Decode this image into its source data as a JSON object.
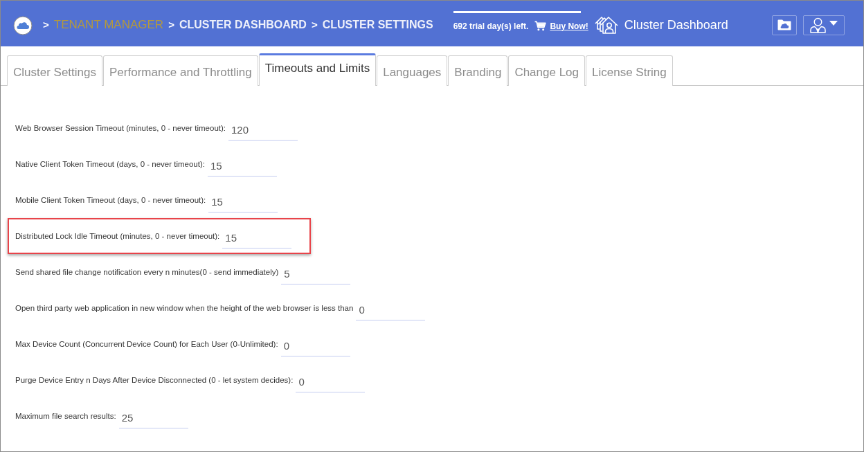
{
  "header": {
    "breadcrumb": [
      {
        "separator": ">",
        "label": "TENANT MANAGER",
        "kind": "link"
      },
      {
        "separator": ">",
        "label": "CLUSTER DASHBOARD",
        "kind": "page"
      },
      {
        "separator": ">",
        "label": "CLUSTER SETTINGS",
        "kind": "page"
      }
    ],
    "trial": {
      "text": "692 trial day(s) left.",
      "link": "Buy Now!"
    },
    "title": "Cluster Dashboard"
  },
  "tabs": [
    {
      "label": "Cluster Settings",
      "selected": false
    },
    {
      "label": "Performance and Throttling",
      "selected": false
    },
    {
      "label": "Timeouts and Limits",
      "selected": true
    },
    {
      "label": "Languages",
      "selected": false
    },
    {
      "label": "Branding",
      "selected": false
    },
    {
      "label": "Change Log",
      "selected": false
    },
    {
      "label": "License String",
      "selected": false
    }
  ],
  "settings": [
    {
      "label": "Web Browser Session Timeout (minutes, 0 - never timeout):",
      "value": "120",
      "highlighted": false
    },
    {
      "label": "Native Client Token Timeout (days, 0 - never timeout):",
      "value": "15",
      "highlighted": false
    },
    {
      "label": "Mobile Client Token Timeout (days, 0 - never timeout):",
      "value": "15",
      "highlighted": false
    },
    {
      "label": "Distributed Lock Idle Timeout (minutes, 0 - never timeout):",
      "value": "15",
      "highlighted": true
    },
    {
      "label": "Send shared file change notification every n minutes(0 - send immediately)",
      "value": "5",
      "highlighted": false
    },
    {
      "label": "Open third party web application in new window when the height of the web browser is less than",
      "value": "0",
      "highlighted": false
    },
    {
      "label": "Max Device Count (Concurrent Device Count) for Each User (0-Unlimited):",
      "value": "0",
      "highlighted": false
    },
    {
      "label": "Purge Device Entry n Days After Device Disconnected (0 - let system decides):",
      "value": "0",
      "highlighted": false
    },
    {
      "label": "Maximum file search results:",
      "value": "25",
      "highlighted": false
    }
  ]
}
